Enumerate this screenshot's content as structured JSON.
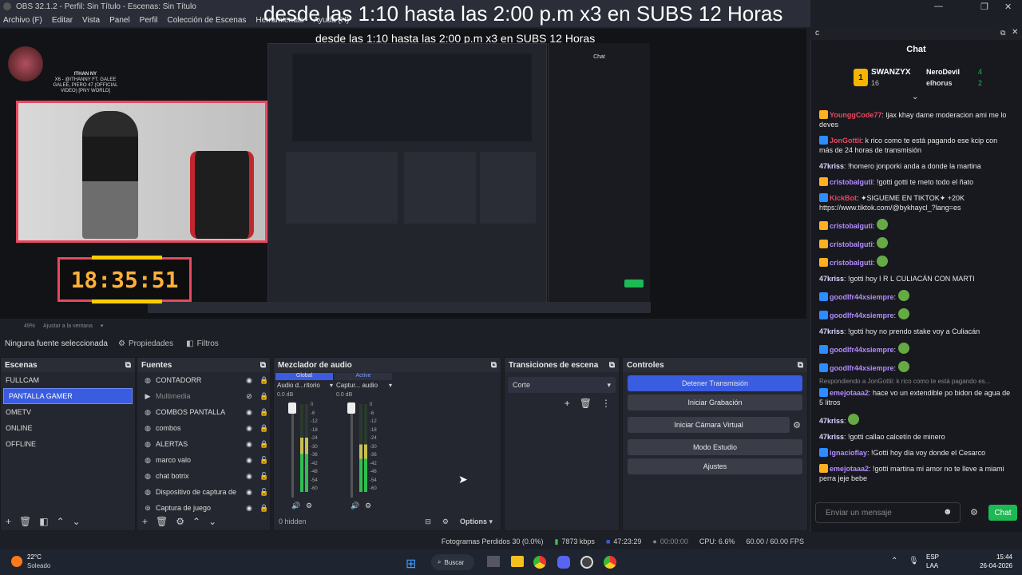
{
  "window": {
    "title": "OBS 32.1.2 - Perfil: Sin Título - Escenas: Sin Título"
  },
  "menu": [
    "Archivo (F)",
    "Editar",
    "Vista",
    "Panel",
    "Perfil",
    "Colección de Escenas",
    "Herramientas",
    "Ayuda (H)"
  ],
  "overlay_title": "desde las 1:10 hasta las 2:00 p.m x3 en SUBS 12 Horas",
  "preview": {
    "sub_title": "desde las 1:10 hasta las 2:00 p.m x3 en SUBS 12 Horas",
    "clock": "18:35:51",
    "avatar_name": "ITHAN NY",
    "avatar_song": "X6 - @ITHANNY FT. GALEE GALEE, PIERO 47 (OFFICIAL VIDEO) [PNY WORLD]",
    "zoom": "49%",
    "fit_label": "Ajustar a la ventana"
  },
  "source_toolbar": {
    "selected": "Ninguna fuente seleccionada",
    "properties": "Propiedades",
    "filters": "Filtros"
  },
  "scenes": {
    "title": "Escenas",
    "items": [
      "FULLCAM",
      "PANTALLA GAMER",
      "OMETV",
      "ONLINE",
      "OFFLINE"
    ],
    "selected_index": 1
  },
  "sources": {
    "title": "Fuentes",
    "items": [
      {
        "name": "CONTADORR",
        "icon": "globe-icon",
        "visible": true,
        "locked": true,
        "muted": false
      },
      {
        "name": "Multimedia",
        "icon": "play-icon",
        "visible": false,
        "locked": true,
        "muted": true
      },
      {
        "name": "COMBOS PANTALLA",
        "icon": "globe-icon",
        "visible": true,
        "locked": true,
        "muted": false
      },
      {
        "name": "combos",
        "icon": "globe-icon",
        "visible": true,
        "locked": true,
        "muted": false
      },
      {
        "name": "ALERTAS",
        "icon": "globe-icon",
        "visible": true,
        "locked": true,
        "muted": false
      },
      {
        "name": "marco valo",
        "icon": "globe-icon",
        "visible": true,
        "locked": false,
        "muted": false
      },
      {
        "name": "chat botrix",
        "icon": "globe-icon",
        "visible": true,
        "locked": false,
        "muted": false
      },
      {
        "name": "Dispositivo de captura de",
        "icon": "globe-icon",
        "visible": true,
        "locked": false,
        "muted": false
      },
      {
        "name": "Captura de juego",
        "icon": "gamepad-icon",
        "visible": true,
        "locked": true,
        "muted": false
      }
    ]
  },
  "mixer": {
    "title": "Mezclador de audio",
    "tab_global": "Global",
    "tab_active": "Active",
    "channels": [
      {
        "name": "Audio d...ritorio",
        "db": "0.0 dB",
        "level": 0.62
      },
      {
        "name": "Captur... audio",
        "db": "0.0 dB",
        "level": 0.54
      }
    ],
    "scale": [
      "0",
      "-6",
      "-12",
      "-18",
      "-24",
      "-30",
      "-36",
      "-42",
      "-48",
      "-54",
      "-60"
    ],
    "hidden": "0 hidden",
    "options": "Options"
  },
  "transitions": {
    "title": "Transiciones de escena",
    "selected": "Corte"
  },
  "controls": {
    "title": "Controles",
    "buttons": [
      "Detener Transmisión",
      "Iniciar Grabación",
      "Iniciar Cámara Virtual",
      "Modo Estudio",
      "Ajustes"
    ]
  },
  "status": {
    "dropped": "Fotogramas Perdidos 30 (0.0%)",
    "bitrate": "7873 kbps",
    "stream_time": "47:23:29",
    "rec_time": "00:00:00",
    "cpu": "CPU: 6.6%",
    "fps": "60.00 / 60.00 FPS"
  },
  "chat": {
    "tab": "c",
    "title": "Chat",
    "leaderboard": [
      {
        "rank": "1",
        "name": "SWANZYX",
        "count": "16"
      },
      {
        "rank": "",
        "name": "NeroDevil",
        "count": "4"
      },
      {
        "rank": "",
        "name": "elhorus",
        "count": "2"
      }
    ],
    "messages": [
      {
        "user": "YounggCode77",
        "color": "#e8485f",
        "text": ": ljax khay dame moderacion ami me lo deves",
        "badge": "#ffb020"
      },
      {
        "user": "JonGottii",
        "color": "#e8485f",
        "text": ": k rico como te está pagando ese kcip con más de 24 horas de transmisión",
        "badge": "#2d8cff"
      },
      {
        "user": "47kriss",
        "color": "#d8d8ff",
        "text": ": !homero jonporki anda a donde la martina",
        "badge": ""
      },
      {
        "user": "cristobalguti",
        "color": "#b48cff",
        "text": ": !gotti gotti te meto todo el ñato",
        "badge": "#ffb020"
      },
      {
        "user": "KickBot",
        "color": "#e8485f",
        "text": ": ✦SIGUEME EN TIKTOK✦ +20K https://www.tiktok.com/@bykhaycl_?lang=es",
        "badge": "#2d8cff"
      },
      {
        "user": "cristobalguti",
        "color": "#b48cff",
        "text": ":",
        "badge": "#ffb020"
      },
      {
        "user": "cristobalguti",
        "color": "#b48cff",
        "text": ":",
        "badge": "#ffb020"
      },
      {
        "user": "cristobalguti",
        "color": "#b48cff",
        "text": ":",
        "badge": "#ffb020"
      },
      {
        "user": "47kriss",
        "color": "#d8d8ff",
        "text": ": !gotti hoy I R L CULIACÁN CON MARTI",
        "badge": ""
      },
      {
        "user": "goodlfr44xsiempre",
        "color": "#b48cff",
        "text": ":",
        "badge": "#2d8cff"
      },
      {
        "user": "goodlfr44xsiempre",
        "color": "#b48cff",
        "text": ":",
        "badge": "#2d8cff"
      },
      {
        "user": "47kriss",
        "color": "#d8d8ff",
        "text": ": !gotti hoy no prendo stake voy a Culiacán",
        "badge": ""
      },
      {
        "user": "goodlfr44xsiempre",
        "color": "#b48cff",
        "text": ":",
        "badge": "#2d8cff"
      },
      {
        "user": "goodlfr44xsiempre",
        "color": "#b48cff",
        "text": ":",
        "badge": "#2d8cff"
      },
      {
        "user": "emejotaaa2",
        "color": "#b48cff",
        "text": ": hace vo un extendible po bidon de agua de 5 litros",
        "badge": "#2d8cff",
        "reply": "Respondiendo a JonGottii: k rico como te está pagando es..."
      },
      {
        "user": "47kriss",
        "color": "#d8d8ff",
        "text": ":",
        "badge": ""
      },
      {
        "user": "47kriss",
        "color": "#d8d8ff",
        "text": ": !gotti callao calcetín de minero",
        "badge": ""
      },
      {
        "user": "ignacioflay",
        "color": "#b48cff",
        "text": ": !Gotti hoy día voy donde el Cesarco",
        "badge": "#2d8cff"
      },
      {
        "user": "emejotaaa2",
        "color": "#b48cff",
        "text": ": !gotti martina mi amor no te lleve a miami perra jeje bebe",
        "badge": "#ffb020"
      }
    ],
    "input_placeholder": "Enviar un mensaje",
    "send": "Chat"
  },
  "taskbar": {
    "weather_temp": "22°C",
    "weather_text": "Soleado",
    "search": "Buscar",
    "lang1": "ESP",
    "lang2": "LAA",
    "time": "15:44",
    "date": "26-04-2026"
  }
}
